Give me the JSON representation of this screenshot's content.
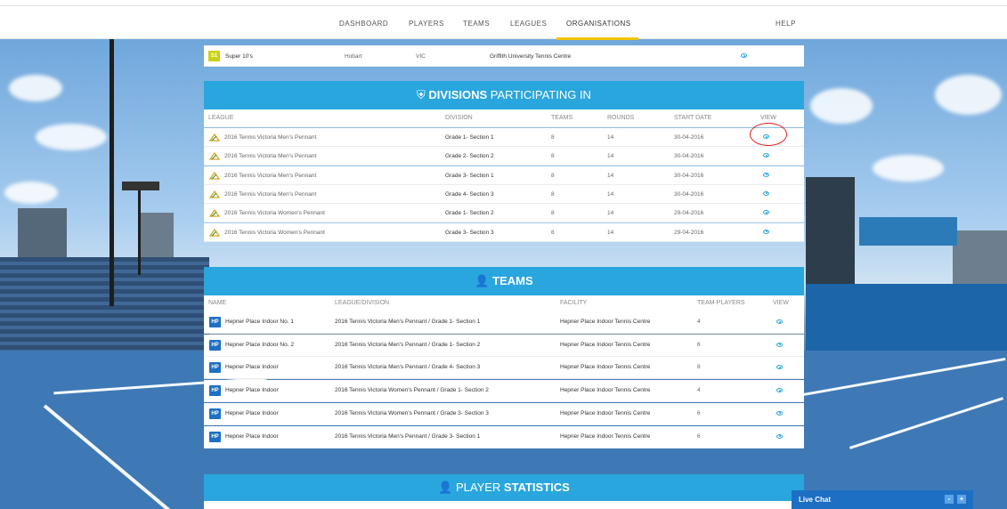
{
  "nav": {
    "items": [
      "DASHBOARD",
      "PLAYERS",
      "TEAMS",
      "LEAGUES",
      "ORGANISATIONS"
    ],
    "help": "HELP",
    "active": "ORGANISATIONS"
  },
  "partial_row": {
    "badge": "S1",
    "name": "Super 10's",
    "city": "Hobart",
    "state": "VIC",
    "facility": "Griffith University Tennis Centre"
  },
  "divisions": {
    "title_bold": "DIVISIONS",
    "title_rest": " PARTICIPATING IN",
    "headers": [
      "LEAGUE",
      "DIVISION",
      "TEAMS",
      "ROUNDS",
      "START DATE",
      "VIEW"
    ],
    "rows": [
      {
        "league": "2016 Tennis Victoria Men's Pennant",
        "division": "Grade 1- Section 1",
        "teams": "8",
        "rounds": "14",
        "start": "30-04-2016"
      },
      {
        "league": "2016 Tennis Victoria Men's Pennant",
        "division": "Grade 2- Section 2",
        "teams": "8",
        "rounds": "14",
        "start": "30-04-2016"
      },
      {
        "league": "2016 Tennis Victoria Men's Pennant",
        "division": "Grade 3- Section 1",
        "teams": "8",
        "rounds": "14",
        "start": "30-04-2016"
      },
      {
        "league": "2016 Tennis Victoria Men's Pennant",
        "division": "Grade 4- Section 3",
        "teams": "8",
        "rounds": "14",
        "start": "30-04-2016"
      },
      {
        "league": "2016 Tennis Victoria Women's Pennant",
        "division": "Grade 1- Section 2",
        "teams": "8",
        "rounds": "14",
        "start": "29-04-2016"
      },
      {
        "league": "2016 Tennis Victoria Women's Pennant",
        "division": "Grade 3- Section 3",
        "teams": "8",
        "rounds": "14",
        "start": "29-04-2016"
      }
    ]
  },
  "teams": {
    "title": "TEAMS",
    "headers": [
      "NAME",
      "LEAGUE/DIVISION",
      "FACILITY",
      "TEAM-PLAYERS",
      "VIEW"
    ],
    "rows": [
      {
        "badge": "HP",
        "name": "Hepner Place Indoor No. 1",
        "league": "2016 Tennis Victoria Men's Pennant / Grade 1- Section 1",
        "facility": "Hepner Place Indoor Tennis Centre",
        "players": "4"
      },
      {
        "badge": "HP",
        "name": "Hepner Place Indoor No. 2",
        "league": "2016 Tennis Victoria Men's Pennant / Grade 1- Section 2",
        "facility": "Hepner Place Indoor Tennis Centre",
        "players": "6"
      },
      {
        "badge": "HP",
        "name": "Hepner Place Indoor",
        "league": "2016 Tennis Victoria Men's Pennant / Grade 4- Section 3",
        "facility": "Hepner Place Indoor Tennis Centre",
        "players": "8"
      },
      {
        "badge": "HP",
        "name": "Hepner Place Indoor",
        "league": "2016 Tennis Victoria Women's Pennant / Grade 1- Section 2",
        "facility": "Hepner Place Indoor Tennis Centre",
        "players": "4"
      },
      {
        "badge": "HP",
        "name": "Hepner Place Indoor",
        "league": "2016 Tennis Victoria Women's Pennant / Grade 3- Section 3",
        "facility": "Hepner Place Indoor Tennis Centre",
        "players": "6"
      },
      {
        "badge": "HP",
        "name": "Hepner Place Indoor",
        "league": "2016 Tennis Victoria Men's Pennant / Grade 3- Section 1",
        "facility": "Hepner Place Indoor Tennis Centre",
        "players": "6"
      }
    ]
  },
  "player_stats": {
    "title_light": "PLAYER ",
    "title_bold": "STATISTICS"
  },
  "live_chat": {
    "label": "Live Chat",
    "minimize": "-",
    "expand": "+"
  },
  "colors": {
    "accent": "#29a6de",
    "nav_active": "#f2c400",
    "badge_blue": "#1d6fc4",
    "highlight": "#e21b1b"
  }
}
